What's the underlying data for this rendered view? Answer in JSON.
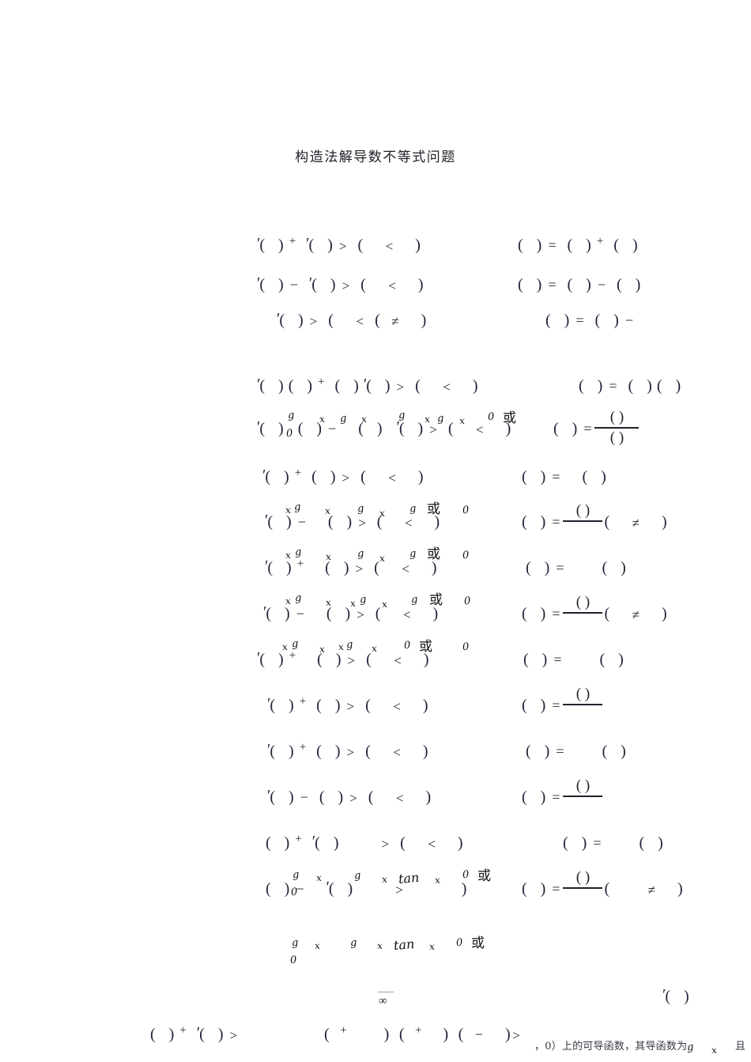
{
  "document": {
    "title": "构造法解导数不等式问题",
    "language": "zh-CN",
    "page_background": "#ffffff",
    "ink_color": "#22222e",
    "handwriting_color": "#111111"
  },
  "glyphs": {
    "paren_pair": "( )",
    "paren_open": "(",
    "paren_close": ")",
    "prime": "′",
    "plus": "+",
    "minus": "−",
    "equals": "=",
    "greater": ">",
    "less": "<",
    "not_equal": "≠",
    "infinity": "∞",
    "comma": "，"
  },
  "rows": [
    {
      "id": "row-1",
      "lhs": "′( )+ ′( )> (  < )",
      "rhs": "( )= ( )+ ( )",
      "annotations": []
    },
    {
      "id": "row-2",
      "lhs": "′( )− ′( )> (  < )",
      "rhs": "( )= ( )− ( )",
      "annotations": []
    },
    {
      "id": "row-3",
      "lhs": "′( )> (  < )( ≠ )",
      "rhs": "( )= ( )−",
      "annotations": []
    },
    {
      "id": "row-4",
      "lhs": "′( )( )+ ( )′( )> (  < )",
      "rhs": "( )= ( )( )",
      "annotations": []
    },
    {
      "id": "row-5",
      "lhs": "′( )( )− ( )′( )> (  < )  0  或",
      "rhs": "( )= ( ) / ( )",
      "annotations": [
        "g",
        "x",
        "0",
        "g",
        "x",
        "g",
        "x",
        "0",
        "或"
      ]
    },
    {
      "id": "row-6",
      "lhs": "′( )+ ( )> (  < )",
      "rhs": "( )= ( )",
      "annotations": []
    },
    {
      "id": "row-7",
      "lhs": "′( )− ( )> (  < )  0  或  0",
      "rhs": "( )= ( ) / ( )( ≠ )",
      "annotations": [
        "x",
        "g",
        "x",
        "g",
        "g",
        "或",
        "0"
      ]
    },
    {
      "id": "row-8",
      "lhs": "′( )+ ( )> (  < )  0  或  0",
      "rhs": "( )= ( )",
      "annotations": [
        "x",
        "g",
        "x",
        "g",
        "g",
        "或",
        "0"
      ]
    },
    {
      "id": "row-9",
      "lhs": "′( )− ( )> (  < )  0  或  0",
      "rhs": "( )= ( ) / ( )( ≠ )",
      "annotations": [
        "x",
        "g",
        "x",
        "g",
        "g",
        "或",
        "0"
      ]
    },
    {
      "id": "row-10",
      "lhs": "′( )+ ( )> (  < )  0  或  0",
      "rhs": "( )= ( )",
      "annotations": [
        "x",
        "g",
        "x",
        "g",
        "或",
        "0"
      ]
    },
    {
      "id": "row-11",
      "lhs": "′( )+ ( )> (  < )",
      "rhs": "( )= ( ) /",
      "annotations": []
    },
    {
      "id": "row-12",
      "lhs": "′( )+ ( )> (  < )",
      "rhs": "( )= ( )",
      "annotations": []
    },
    {
      "id": "row-13",
      "lhs": "′( )− ( )> (  < )",
      "rhs": "( )= ( ) /",
      "annotations": []
    },
    {
      "id": "row-14",
      "lhs": "( )+ ′( )  > (  < )",
      "rhs": "( )= ( )",
      "annotations": []
    },
    {
      "id": "row-15",
      "lhs": "( )− ( ) ′( )  >  tan  ( )  0  或",
      "rhs": "( )= ( ) / ( ) ( ≠ )",
      "annotations": [
        "g",
        "0",
        "x",
        "g",
        "x",
        "tan",
        "x",
        "0",
        "或"
      ]
    },
    {
      "id": "row-16",
      "lhs": "g x   g x tan x   0  或",
      "rhs": "",
      "annotations": [
        "g",
        "x",
        "g",
        "x",
        "tan",
        "x",
        "0",
        "或"
      ]
    },
    {
      "id": "row-17",
      "lhs": "( )+ ′( )>     ( +   ) ( + )( − )>",
      "rhs": "′( )",
      "annotations": []
    }
  ],
  "footer": {
    "infinity_symbol": "∞",
    "chinese_fragment": "，0）上的可导函数，其导函数为",
    "handwritten_tail": "g  x  ，且"
  }
}
